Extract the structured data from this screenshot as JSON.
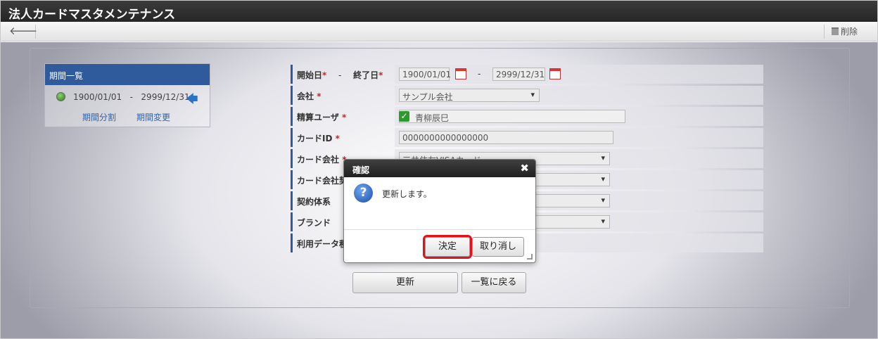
{
  "title": "法人カードマスタメンテナンス",
  "toolbar": {
    "back_icon": "arrow-left-icon",
    "delete_label": "削除"
  },
  "period_list": {
    "header": "期間一覧",
    "item": {
      "start": "1900/01/01",
      "separator": "-",
      "end": "2999/12/31"
    },
    "split_link": "期間分割",
    "change_link": "期間変更"
  },
  "form": {
    "period": {
      "start_label": "開始日",
      "end_label": "終了日",
      "required": "*",
      "dash": "-",
      "start_value": "1900/01/01",
      "end_value": "2999/12/31"
    },
    "company": {
      "label": "会社",
      "required": "*",
      "value": "サンプル会社"
    },
    "settlement_user": {
      "label": "精算ユーザ",
      "required": "*",
      "value": "青柳辰巳"
    },
    "card_id": {
      "label": "カードID",
      "required": "*",
      "value": "0000000000000000"
    },
    "card_company": {
      "label": "カード会社",
      "required": "*",
      "value": "三井住友VISAカード"
    },
    "card_company_contract": {
      "label": "カード会社契約"
    },
    "contract_system": {
      "label": "契約体系"
    },
    "brand": {
      "label": "ブランド"
    },
    "usage_data": {
      "label": "利用データ種別"
    }
  },
  "buttons": {
    "update": "更新",
    "back_to_list": "一覧に戻る"
  },
  "dialog": {
    "title": "確認",
    "close": "✖",
    "message": "更新します。",
    "ok": "決定",
    "cancel": "取り消し"
  },
  "colors": {
    "accent": "#2f5b9c",
    "highlight": "#e0121e",
    "titlebar": "#2b2b2b"
  }
}
